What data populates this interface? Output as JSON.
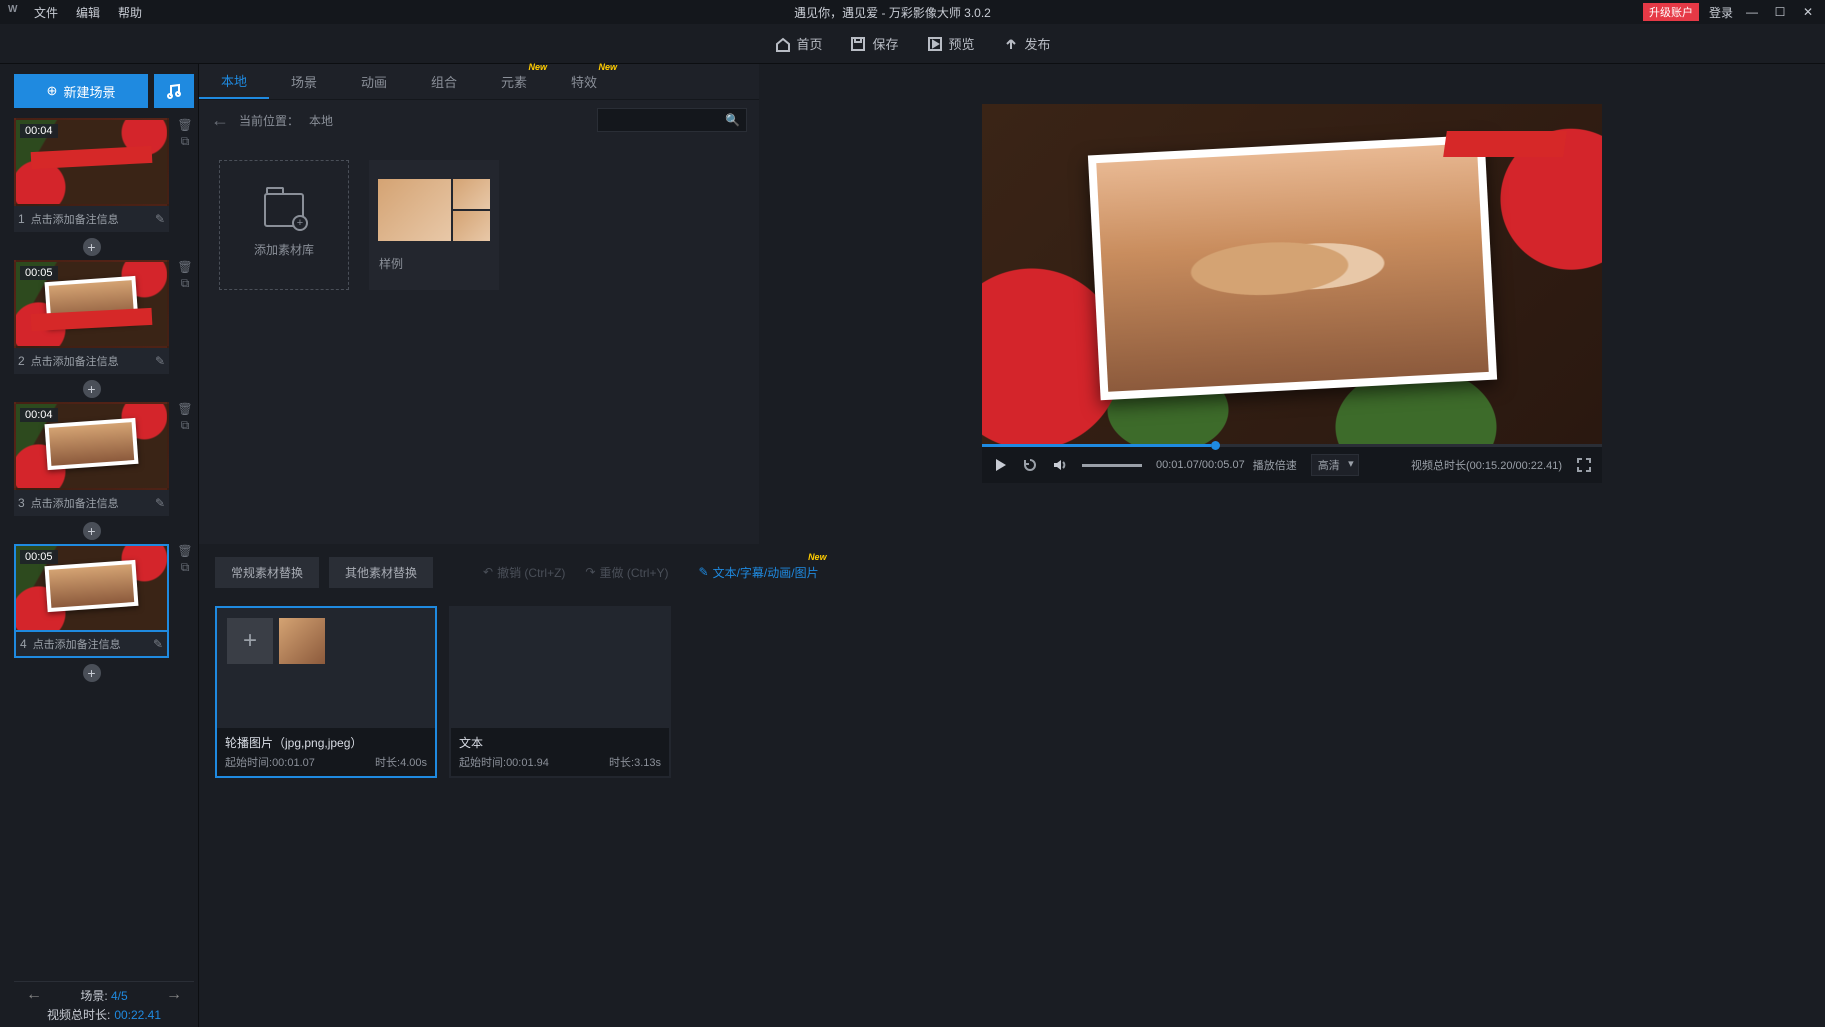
{
  "titlebar": {
    "menu_file": "文件",
    "menu_edit": "编辑",
    "menu_help": "帮助",
    "title": "遇见你，遇见爱 - 万彩影像大师 3.0.2",
    "upgrade": "升级账户",
    "login": "登录"
  },
  "toolbar": {
    "home": "首页",
    "save": "保存",
    "preview": "预览",
    "publish": "发布"
  },
  "sidebar": {
    "new_scene": "新建场景",
    "scenes": [
      {
        "dur": "00:04",
        "num": "1",
        "note": "点击添加备注信息"
      },
      {
        "dur": "00:05",
        "num": "2",
        "note": "点击添加备注信息"
      },
      {
        "dur": "00:04",
        "num": "3",
        "note": "点击添加备注信息"
      },
      {
        "dur": "00:05",
        "num": "4",
        "note": "点击添加备注信息"
      }
    ],
    "scene_count_label": "场景:",
    "scene_count_val": "4/5",
    "total_label": "视频总时长:",
    "total_val": "00:22.41"
  },
  "assets": {
    "tabs": {
      "local": "本地",
      "scene": "场景",
      "anim": "动画",
      "combo": "组合",
      "element": "元素",
      "effect": "特效",
      "new": "New"
    },
    "bc_label": "当前位置：",
    "bc_val": "本地",
    "add_lib": "添加素材库",
    "sample": "样例"
  },
  "player": {
    "time_text": "00:01.07/00:05.07",
    "rate_label": "播放倍速",
    "quality": "高清",
    "total_label": "视频总时长",
    "total_val": "(00:15.20/00:22.41)"
  },
  "timeline": {
    "tab_normal": "常规素材替换",
    "tab_other": "其他素材替换",
    "undo": "撤销 (Ctrl+Z)",
    "redo": "重做 (Ctrl+Y)",
    "text_link": "文本/字幕/动画/图片",
    "new": "New",
    "clips": [
      {
        "title": "轮播图片（jpg,png,jpeg）",
        "start_label": "起始时间:",
        "start": "00:01.07",
        "dur_label": "时长:",
        "dur": "4.00s"
      },
      {
        "title": "文本",
        "start_label": "起始时间:",
        "start": "00:01.94",
        "dur_label": "时长:",
        "dur": "3.13s"
      }
    ]
  }
}
